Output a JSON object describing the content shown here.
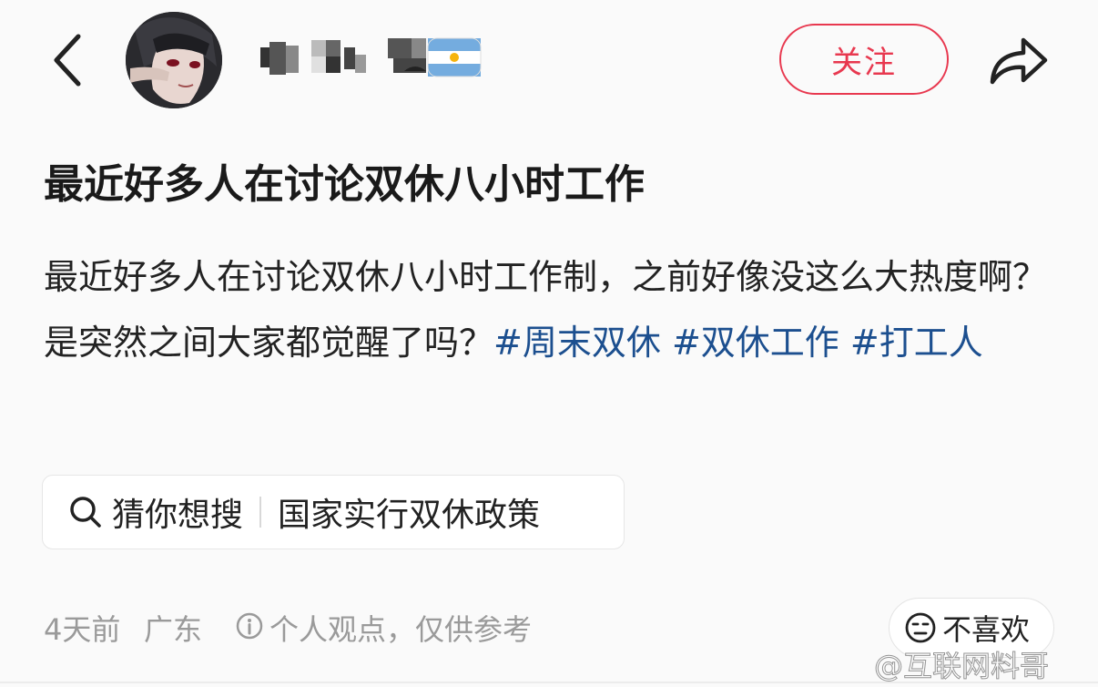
{
  "header": {
    "follow_label": "关注",
    "avatar_icon": "anime-character-avatar",
    "back_icon": "chevron-left-icon",
    "share_icon": "share-arrow-icon",
    "badge_icon": "argentina-flag-badge"
  },
  "post": {
    "title": "最近好多人在讨论双休八小时工作",
    "body_text": "最近好多人在讨论双休八小时工作制，之前好像没这么大热度啊？是突然之间大家都觉醒了吗？",
    "hashtags": [
      "#周末双休",
      "#双休工作",
      "#打工人"
    ]
  },
  "search_suggestion": {
    "label": "猜你想搜",
    "query": "国家实行双休政策"
  },
  "meta": {
    "time": "4天前",
    "location": "广东",
    "opinion_note": "个人观点，仅供参考"
  },
  "dislike_label": "不喜欢",
  "watermark": "@互联网料哥",
  "colors": {
    "accent_red": "#e8384f",
    "hashtag_blue": "#1c4f8f",
    "meta_gray": "#9a9a9a"
  }
}
